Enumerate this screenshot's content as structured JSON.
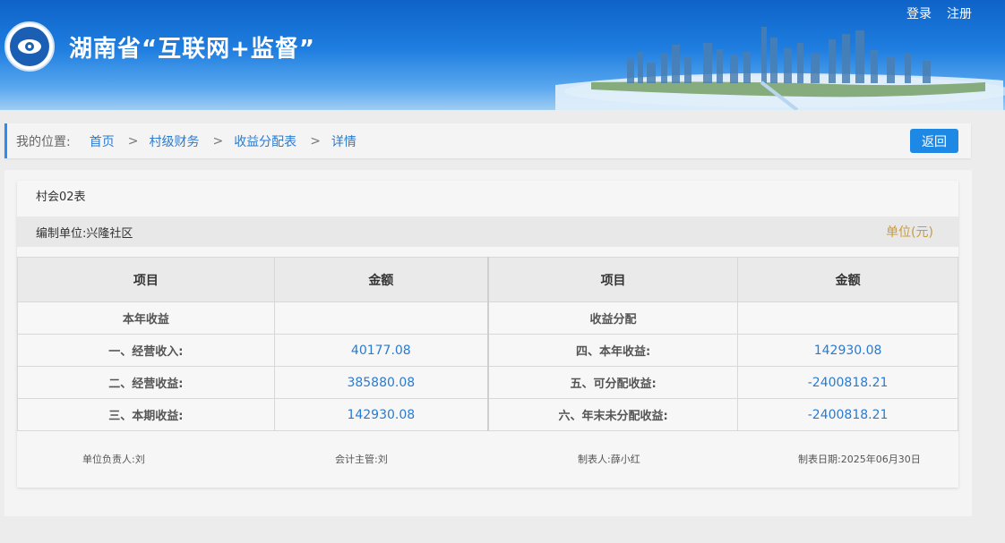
{
  "header": {
    "title": "湖南省“互联网+监督”",
    "login": "登录",
    "register": "注册"
  },
  "breadcrumb": {
    "label": "我的位置:",
    "items": [
      "首页",
      "村级财务",
      "收益分配表",
      "详情"
    ],
    "separator": ">",
    "back_label": "返回"
  },
  "report": {
    "form_code": "村会02表",
    "unit_left": "编制单位:兴隆社区",
    "unit_right": "单位(元)",
    "headers": [
      "项目",
      "金额",
      "项目",
      "金额"
    ],
    "rows": [
      {
        "left_label": "本年收益",
        "left_value": "",
        "right_label": "收益分配",
        "right_value": ""
      },
      {
        "left_label": "一、经营收入:",
        "left_value": "40177.08",
        "right_label": "四、本年收益:",
        "right_value": "142930.08"
      },
      {
        "left_label": "二、经营收益:",
        "left_value": "385880.08",
        "right_label": "五、可分配收益:",
        "right_value": "-2400818.21"
      },
      {
        "left_label": "三、本期收益:",
        "left_value": "142930.08",
        "right_label": "六、年末未分配收益:",
        "right_value": "-2400818.21"
      }
    ],
    "signatures": {
      "head": "单位负责人:刘",
      "accountant": "会计主管:刘",
      "preparer": "制表人:薛小红",
      "date": "制表日期:2025年06月30日"
    }
  },
  "colors": {
    "accent": "#1e88e5",
    "link": "#2a7bd0",
    "unit": "#c99a3e"
  }
}
